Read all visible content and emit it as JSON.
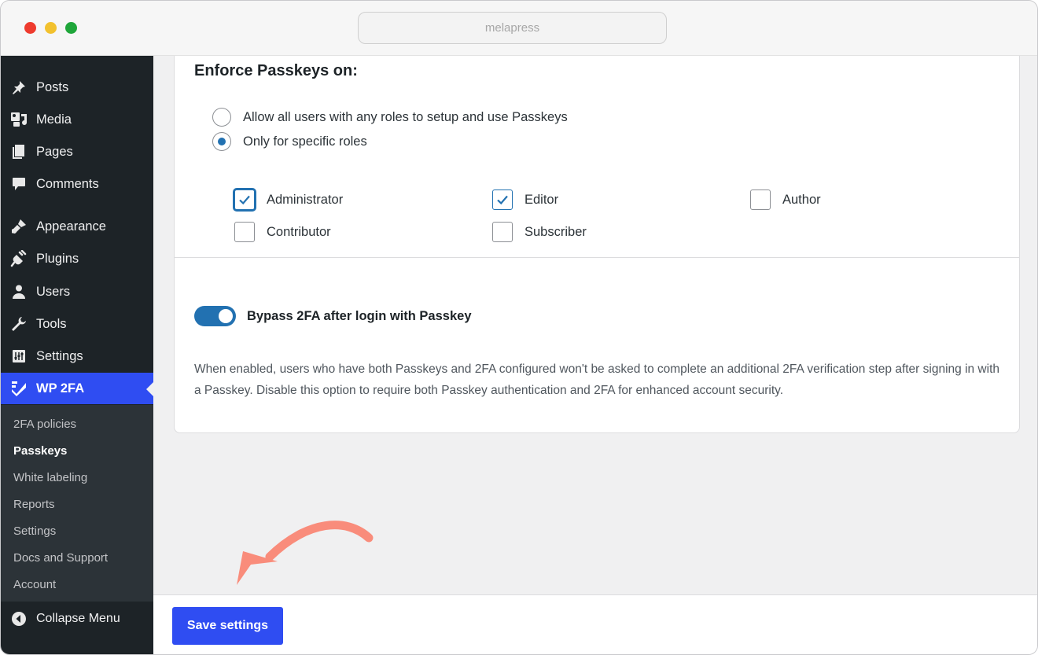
{
  "browser": {
    "url": "melapress"
  },
  "sidebar": {
    "items": [
      {
        "label": "Posts",
        "icon": "pin-icon"
      },
      {
        "label": "Media",
        "icon": "media-icon"
      },
      {
        "label": "Pages",
        "icon": "pages-icon"
      },
      {
        "label": "Comments",
        "icon": "comment-icon"
      },
      {
        "label": "Appearance",
        "icon": "brush-icon"
      },
      {
        "label": "Plugins",
        "icon": "plug-icon"
      },
      {
        "label": "Users",
        "icon": "user-icon"
      },
      {
        "label": "Tools",
        "icon": "wrench-icon"
      },
      {
        "label": "Settings",
        "icon": "sliders-icon"
      },
      {
        "label": "WP 2FA",
        "icon": "wp2fa-icon",
        "active": true
      }
    ],
    "submenu": [
      {
        "label": "2FA policies"
      },
      {
        "label": "Passkeys",
        "current": true
      },
      {
        "label": "White labeling"
      },
      {
        "label": "Reports"
      },
      {
        "label": "Settings"
      },
      {
        "label": "Docs and Support"
      },
      {
        "label": "Account"
      }
    ],
    "collapse_label": "Collapse Menu"
  },
  "main": {
    "section_title": "Enforce Passkeys on:",
    "radios": [
      {
        "label": "Allow all users with any roles to setup and use Passkeys",
        "checked": false
      },
      {
        "label": "Only for specific roles",
        "checked": true
      }
    ],
    "roles": [
      {
        "label": "Administrator",
        "checked": true
      },
      {
        "label": "Editor",
        "checked": true
      },
      {
        "label": "Author",
        "checked": false
      },
      {
        "label": "Contributor",
        "checked": false
      },
      {
        "label": "Subscriber",
        "checked": false
      }
    ],
    "bypass_toggle": {
      "label": "Bypass 2FA after login with Passkey",
      "enabled": true
    },
    "description": "When enabled, users who have both Passkeys and 2FA configured won't be asked to complete an additional 2FA verification step after signing in with a Passkey. Disable this option to require both Passkey authentication and 2FA for enhanced account security."
  },
  "footer": {
    "save_label": "Save settings"
  },
  "colors": {
    "accent": "#2f4df2",
    "wp_blue": "#2271b1",
    "sidebar_bg": "#1d2327",
    "arrow": "#f98c7b"
  }
}
